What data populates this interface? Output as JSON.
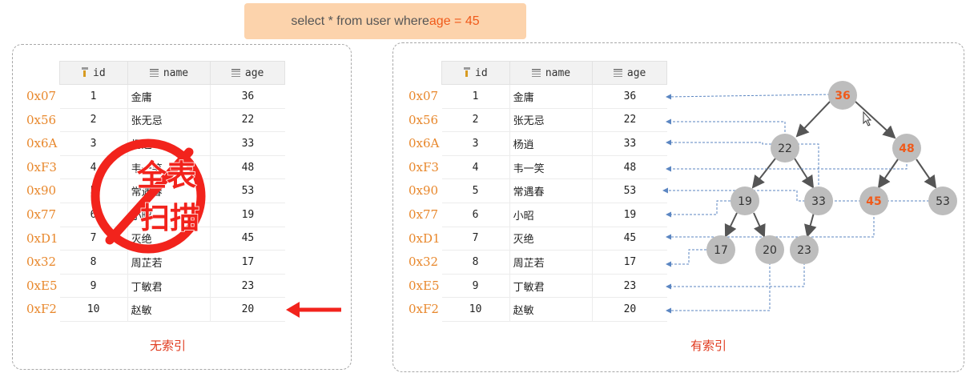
{
  "query": {
    "prefix": "select * from user where ",
    "highlight": "age = 45"
  },
  "columns": {
    "id": "id",
    "name": "name",
    "age": "age"
  },
  "rows": [
    {
      "addr": "0x07",
      "id": "1",
      "name": "金庸",
      "age": "36"
    },
    {
      "addr": "0x56",
      "id": "2",
      "name": "张无忌",
      "age": "22"
    },
    {
      "addr": "0x6A",
      "id": "3",
      "name": "杨逍",
      "age": "33"
    },
    {
      "addr": "0xF3",
      "id": "4",
      "name": "韦一笑",
      "age": "48"
    },
    {
      "addr": "0x90",
      "id": "5",
      "name": "常遇春",
      "age": "53"
    },
    {
      "addr": "0x77",
      "id": "6",
      "name": "小昭",
      "age": "19"
    },
    {
      "addr": "0xD1",
      "id": "7",
      "name": "灭绝",
      "age": "45"
    },
    {
      "addr": "0x32",
      "id": "8",
      "name": "周芷若",
      "age": "17"
    },
    {
      "addr": "0xE5",
      "id": "9",
      "name": "丁敏君",
      "age": "23"
    },
    {
      "addr": "0xF2",
      "id": "10",
      "name": "赵敏",
      "age": "20"
    }
  ],
  "stamp": {
    "line1": "全表",
    "line2": "扫描"
  },
  "captions": {
    "left": "无索引",
    "right": "有索引"
  },
  "tree": {
    "nodes": [
      {
        "key": "36",
        "highlight": true
      },
      {
        "key": "22",
        "highlight": false
      },
      {
        "key": "48",
        "highlight": true
      },
      {
        "key": "19",
        "highlight": false
      },
      {
        "key": "33",
        "highlight": false
      },
      {
        "key": "45",
        "highlight": true
      },
      {
        "key": "53",
        "highlight": false
      },
      {
        "key": "17",
        "highlight": false
      },
      {
        "key": "20",
        "highlight": false
      },
      {
        "key": "23",
        "highlight": false
      }
    ]
  },
  "colors": {
    "highlight": "#f05a1a",
    "node_fill": "#bdbdbd",
    "stamp_red": "#f2231c",
    "arrow_blue": "#5b86c2",
    "address": "#e8872b"
  }
}
